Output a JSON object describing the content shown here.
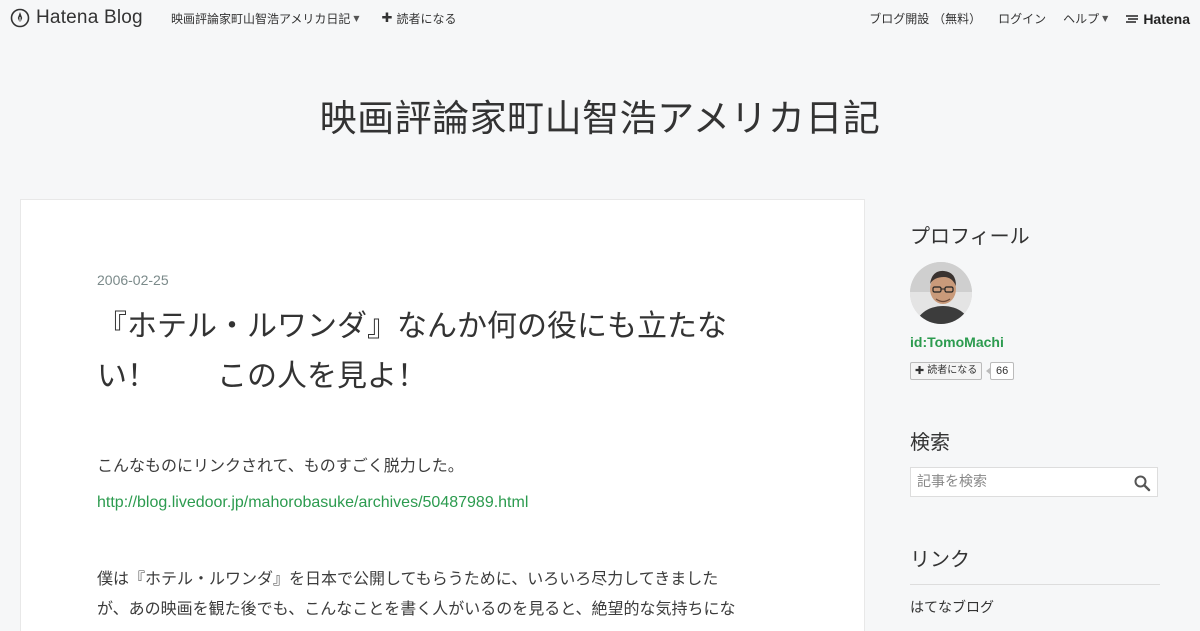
{
  "topbar": {
    "brand": "Hatena Blog",
    "blog_menu": "映画評論家町山智浩アメリカ日記",
    "subscribe": "読者になる",
    "open_blog": "ブログ開設 （無料）",
    "login": "ログイン",
    "help": "ヘルプ",
    "hatena": "Hatena"
  },
  "blog": {
    "title": "映画評論家町山智浩アメリカ日記"
  },
  "entry": {
    "date": "2006-02-25",
    "title_line1": "『ホテル・ルワンダ』なんか何の役にも立たな",
    "title_line2": "い！　　この人を見よ！",
    "paragraph1": "こんなものにリンクされて、ものすごく脱力した。",
    "link": "http://blog.livedoor.jp/mahorobasuke/archives/50487989.html",
    "paragraph2_line1": "僕は『ホテル・ルワンダ』を日本で公開してもらうために、いろいろ尽力してきました",
    "paragraph2_line2": "が、あの映画を観た後でも、こんなことを書く人がいるのを見ると、絶望的な気持ちにな"
  },
  "sidebar": {
    "profile_title": "プロフィール",
    "profile_id": "id:TomoMachi",
    "reader_button": "読者になる",
    "reader_count": "66",
    "search_title": "検索",
    "search_placeholder": "記事を検索",
    "links_title": "リンク",
    "links": [
      "はてなブログ"
    ]
  },
  "colors": {
    "background": "#f6f7f8",
    "card": "#ffffff",
    "accent_green": "#2c9b4f",
    "date_gray": "#7b8a8a"
  }
}
